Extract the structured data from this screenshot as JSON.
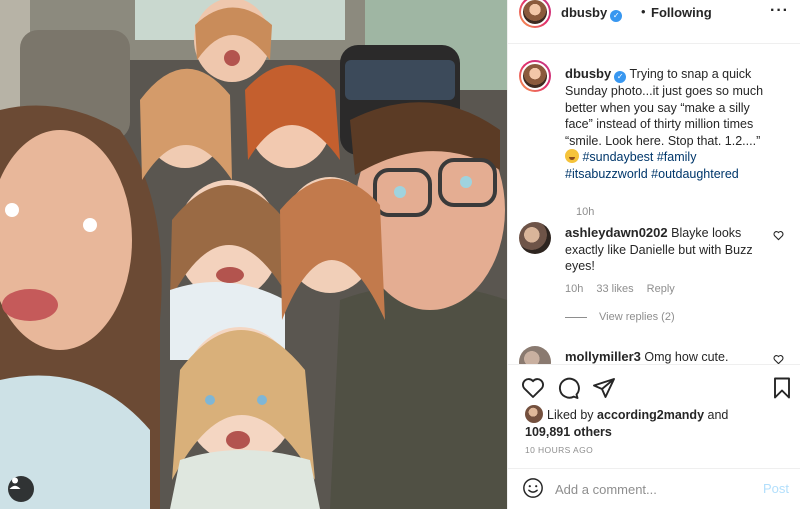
{
  "post": {
    "author": "dbusby",
    "verified_mark": "✓",
    "separator": "•",
    "follow_status": "Following",
    "more_icon": "ellipsis-icon"
  },
  "caption": {
    "author": "dbusby",
    "text": "Trying to snap a quick Sunday photo...it just goes so much better when you say “make a silly face” instead of thirty million times “smile. Look here. Stop that. 1.2....”",
    "hashtags": [
      "#sundaybest",
      "#family",
      "#itsabuzzworld",
      "#outdaughtered"
    ],
    "time": "10h"
  },
  "comments": [
    {
      "author": "ashleydawn0202",
      "text": "Blayke looks exactly like Danielle but with Buzz eyes!",
      "time": "10h",
      "likes": "33 likes",
      "reply_label": "Reply",
      "view_replies": "View replies (2)"
    },
    {
      "author": "mollymiller3",
      "text": "Omg how cute."
    }
  ],
  "likes": {
    "prefix": "Liked by",
    "user": "according2mandy",
    "joiner": "and",
    "count": "109,891 others"
  },
  "timestamp": "10 HOURS AGO",
  "add_comment": {
    "placeholder": "Add a comment...",
    "post_label": "Post"
  },
  "colors": {
    "verified": "#3897f0",
    "hashtag": "#00376b",
    "muted": "#8e8e8e",
    "post_disabled": "#b2dffc"
  }
}
